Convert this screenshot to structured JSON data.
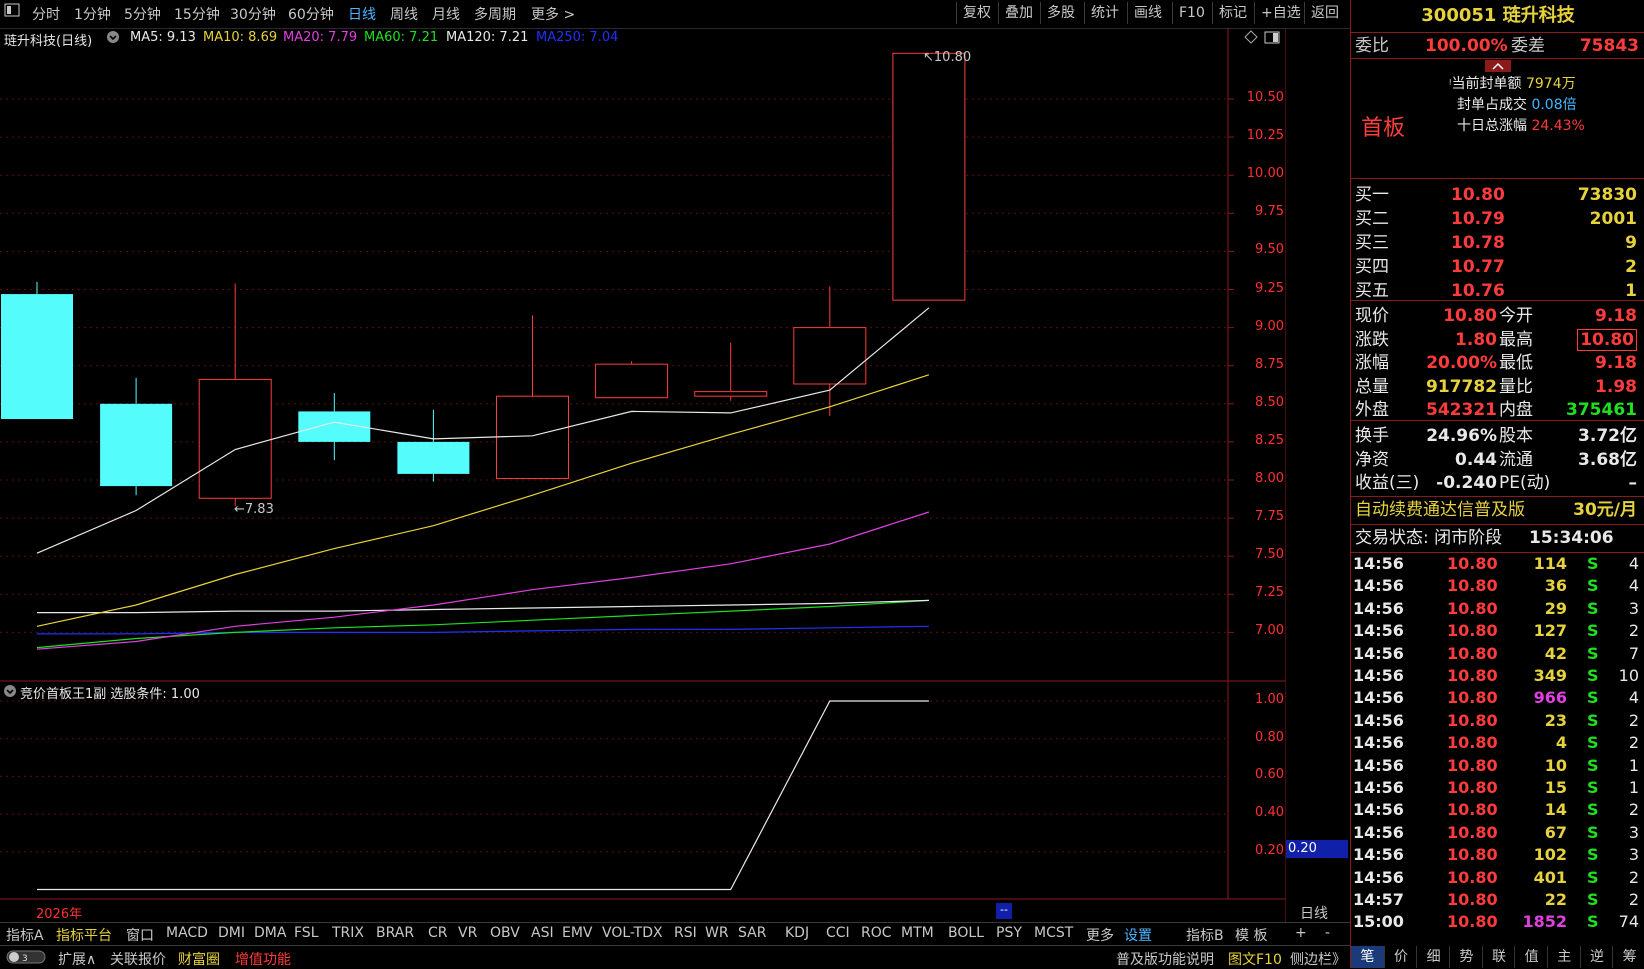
{
  "toolbar": {
    "periods": [
      "分时",
      "1分钟",
      "5分钟",
      "15分钟",
      "30分钟",
      "60分钟",
      "日线",
      "周线",
      "月线",
      "多周期",
      "更多 >"
    ],
    "active_period": "日线",
    "actions": [
      "复权",
      "叠加",
      "多股",
      "统计",
      "画线",
      "F10",
      "标记",
      "+自选",
      "返回"
    ]
  },
  "chart": {
    "title": "琏升科技(日线)",
    "ma_legend": [
      {
        "label": "MA5: 9.13",
        "color": "#e8e8e8"
      },
      {
        "label": "MA10: 8.69",
        "color": "#e6d23c"
      },
      {
        "label": "MA20: 7.79",
        "color": "#e040e0"
      },
      {
        "label": "MA60: 7.21",
        "color": "#1ee01e"
      },
      {
        "label": "MA120: 7.21",
        "color": "#e8e8e8"
      },
      {
        "label": "MA250: 7.04",
        "color": "#2030ff"
      }
    ],
    "high_label": "10.80",
    "low_label": "7.83",
    "year_label": "2026年",
    "period_label": "日线",
    "sub_title": "竞价首板王1副  选股条件: 1.00",
    "sub_value_label": "0.20"
  },
  "chart_data": {
    "type": "candlestick",
    "y_ticks": [
      "10.50",
      "10.25",
      "10.00",
      "9.75",
      "9.50",
      "9.25",
      "9.00",
      "8.75",
      "8.50",
      "8.25",
      "8.00",
      "7.75",
      "7.50",
      "7.25",
      "7.00"
    ],
    "candles": [
      {
        "open": 9.22,
        "close": 8.4,
        "high": 9.3,
        "low": 8.4
      },
      {
        "open": 8.5,
        "close": 7.96,
        "high": 8.67,
        "low": 7.9
      },
      {
        "open": 7.88,
        "close": 8.66,
        "high": 9.29,
        "low": 7.83
      },
      {
        "open": 8.45,
        "close": 8.25,
        "high": 8.57,
        "low": 8.13
      },
      {
        "open": 8.25,
        "close": 8.04,
        "high": 8.46,
        "low": 7.99
      },
      {
        "open": 8.01,
        "close": 8.55,
        "high": 9.08,
        "low": 8.01
      },
      {
        "open": 8.54,
        "close": 8.76,
        "high": 8.78,
        "low": 8.54
      },
      {
        "open": 8.55,
        "close": 8.58,
        "high": 8.9,
        "low": 8.52
      },
      {
        "open": 8.63,
        "close": 9.0,
        "high": 9.27,
        "low": 8.42
      },
      {
        "open": 9.18,
        "close": 10.8,
        "high": 10.8,
        "low": 9.18
      }
    ],
    "ma5": [
      7.52,
      7.8,
      8.2,
      8.38,
      8.27,
      8.29,
      8.45,
      8.44,
      8.59,
      9.13
    ],
    "ma10": [
      7.04,
      7.18,
      7.38,
      7.55,
      7.7,
      7.9,
      8.11,
      8.3,
      8.48,
      8.69
    ],
    "ma20": [
      6.89,
      6.94,
      7.04,
      7.1,
      7.18,
      7.28,
      7.36,
      7.45,
      7.58,
      7.79
    ],
    "ma60": [
      6.9,
      6.96,
      7.0,
      7.03,
      7.05,
      7.08,
      7.11,
      7.14,
      7.17,
      7.21
    ],
    "ma120": [
      7.13,
      7.13,
      7.14,
      7.14,
      7.15,
      7.16,
      7.17,
      7.18,
      7.19,
      7.21
    ],
    "ma250": [
      6.99,
      6.99,
      7.0,
      7.0,
      7.0,
      7.01,
      7.02,
      7.02,
      7.03,
      7.04
    ],
    "sub_ticks": [
      "1.00",
      "0.80",
      "0.60",
      "0.40",
      "0.20"
    ],
    "sub_series": [
      0,
      0,
      0,
      0,
      0,
      0,
      0,
      0,
      1,
      1
    ]
  },
  "quote": {
    "code": "300051",
    "name": "琏升科技",
    "weibi_label": "委比",
    "weibi_value": "100.00%",
    "weicha_label": "委差",
    "weicha_value": "75843",
    "board_label": "首板",
    "seal_amount_label": "当前封单额",
    "seal_amount": "7974万",
    "seal_ratio_label": "封单占成交",
    "seal_ratio": "0.08倍",
    "ten_day_label": "十日总涨幅",
    "ten_day": "24.43%",
    "bids": [
      {
        "label": "买一",
        "price": "10.80",
        "vol": "73830"
      },
      {
        "label": "买二",
        "price": "10.79",
        "vol": "2001"
      },
      {
        "label": "买三",
        "price": "10.78",
        "vol": "9"
      },
      {
        "label": "买四",
        "price": "10.77",
        "vol": "2"
      },
      {
        "label": "买五",
        "price": "10.76",
        "vol": "1"
      }
    ],
    "stats_left": [
      {
        "label": "现价",
        "value": "10.80",
        "color": "red"
      },
      {
        "label": "涨跌",
        "value": "1.80",
        "color": "red"
      },
      {
        "label": "涨幅",
        "value": "20.00%",
        "color": "red"
      },
      {
        "label": "总量",
        "value": "917782",
        "color": "yellow"
      },
      {
        "label": "外盘",
        "value": "542321",
        "color": "red"
      }
    ],
    "stats_right": [
      {
        "label": "今开",
        "value": "9.18",
        "color": "red"
      },
      {
        "label": "最高",
        "value": "10.80",
        "color": "red"
      },
      {
        "label": "最低",
        "value": "9.18",
        "color": "red"
      },
      {
        "label": "量比",
        "value": "1.98",
        "color": "red"
      },
      {
        "label": "内盘",
        "value": "375461",
        "color": "green"
      }
    ],
    "fund_left": [
      {
        "label": "换手",
        "value": "24.96%"
      },
      {
        "label": "净资",
        "value": "0.44"
      },
      {
        "label": "收益(三)",
        "value": "-0.240"
      }
    ],
    "fund_right": [
      {
        "label": "股本",
        "value": "3.72亿"
      },
      {
        "label": "流通",
        "value": "3.68亿"
      },
      {
        "label": "PE(动)",
        "value": "–"
      }
    ],
    "promo": "自动续费通达信普及版",
    "promo_price": "30元/月",
    "trade_state_label": "交易状态: 闭市阶段",
    "trade_time": "15:34:06"
  },
  "ticks": [
    {
      "t": "14:56",
      "p": "10.80",
      "v": "114",
      "c": "yellow",
      "d": "S",
      "n": "4"
    },
    {
      "t": "14:56",
      "p": "10.80",
      "v": "36",
      "c": "yellow",
      "d": "S",
      "n": "4"
    },
    {
      "t": "14:56",
      "p": "10.80",
      "v": "29",
      "c": "yellow",
      "d": "S",
      "n": "3"
    },
    {
      "t": "14:56",
      "p": "10.80",
      "v": "127",
      "c": "yellow",
      "d": "S",
      "n": "2"
    },
    {
      "t": "14:56",
      "p": "10.80",
      "v": "42",
      "c": "yellow",
      "d": "S",
      "n": "7"
    },
    {
      "t": "14:56",
      "p": "10.80",
      "v": "349",
      "c": "yellow",
      "d": "S",
      "n": "10"
    },
    {
      "t": "14:56",
      "p": "10.80",
      "v": "966",
      "c": "mag",
      "d": "S",
      "n": "4"
    },
    {
      "t": "14:56",
      "p": "10.80",
      "v": "23",
      "c": "yellow",
      "d": "S",
      "n": "2"
    },
    {
      "t": "14:56",
      "p": "10.80",
      "v": "4",
      "c": "yellow",
      "d": "S",
      "n": "2"
    },
    {
      "t": "14:56",
      "p": "10.80",
      "v": "10",
      "c": "yellow",
      "d": "S",
      "n": "1"
    },
    {
      "t": "14:56",
      "p": "10.80",
      "v": "15",
      "c": "yellow",
      "d": "S",
      "n": "1"
    },
    {
      "t": "14:56",
      "p": "10.80",
      "v": "14",
      "c": "yellow",
      "d": "S",
      "n": "2"
    },
    {
      "t": "14:56",
      "p": "10.80",
      "v": "67",
      "c": "yellow",
      "d": "S",
      "n": "3"
    },
    {
      "t": "14:56",
      "p": "10.80",
      "v": "102",
      "c": "yellow",
      "d": "S",
      "n": "3"
    },
    {
      "t": "14:56",
      "p": "10.80",
      "v": "401",
      "c": "yellow",
      "d": "S",
      "n": "2"
    },
    {
      "t": "14:57",
      "p": "10.80",
      "v": "22",
      "c": "yellow",
      "d": "S",
      "n": "2"
    },
    {
      "t": "15:00",
      "p": "10.80",
      "v": "1852",
      "c": "mag",
      "d": "S",
      "n": "74"
    }
  ],
  "indicators": [
    "指标A",
    "指标平台",
    "窗口",
    "MACD",
    "DMI",
    "DMA",
    "FSL",
    "TRIX",
    "BRAR",
    "CR",
    "VR",
    "OBV",
    "ASI",
    "EMV",
    "VOL-TDX",
    "RSI",
    "WR",
    "SAR",
    "KDJ",
    "CCI",
    "ROC",
    "MTM",
    "BOLL",
    "PSY",
    "MCST",
    "更多",
    "设置",
    "指标B",
    "模 板",
    "+",
    "-"
  ],
  "status_left": [
    "扩展∧",
    "关联报价",
    "财富圈",
    "增值功能"
  ],
  "status_right": [
    "普及版功能说明",
    "图文F10",
    "侧边栏》"
  ],
  "panel_tabs": [
    "笔",
    "价",
    "细",
    "势",
    "联",
    "值",
    "主",
    "逆",
    "筹"
  ]
}
